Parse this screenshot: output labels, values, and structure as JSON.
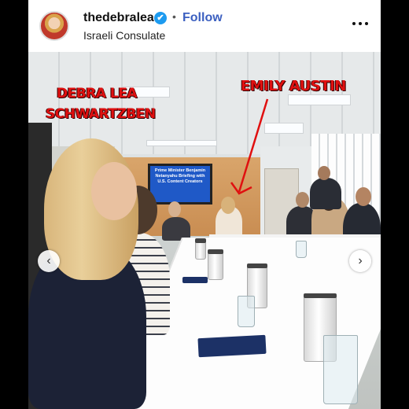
{
  "post": {
    "username": "thedebralea",
    "verified_symbol": "✔",
    "separator": "•",
    "follow_label": "Follow",
    "location": "Israeli Consulate",
    "more_icon": "more-horizontal-icon"
  },
  "photo": {
    "screen_text": "Prime Minister Benjamin Netanyahu Briefing with U.S. Content Creators",
    "annotations": {
      "debra": "DEBRA LEA SCHWARTZBEN",
      "emily": "EMILY AUSTIN"
    },
    "annotation_color": "#e01010"
  },
  "carousel": {
    "prev_glyph": "‹",
    "next_glyph": "›"
  },
  "colors": {
    "follow": "#3b5fc0",
    "verified": "#1d9bf0"
  }
}
